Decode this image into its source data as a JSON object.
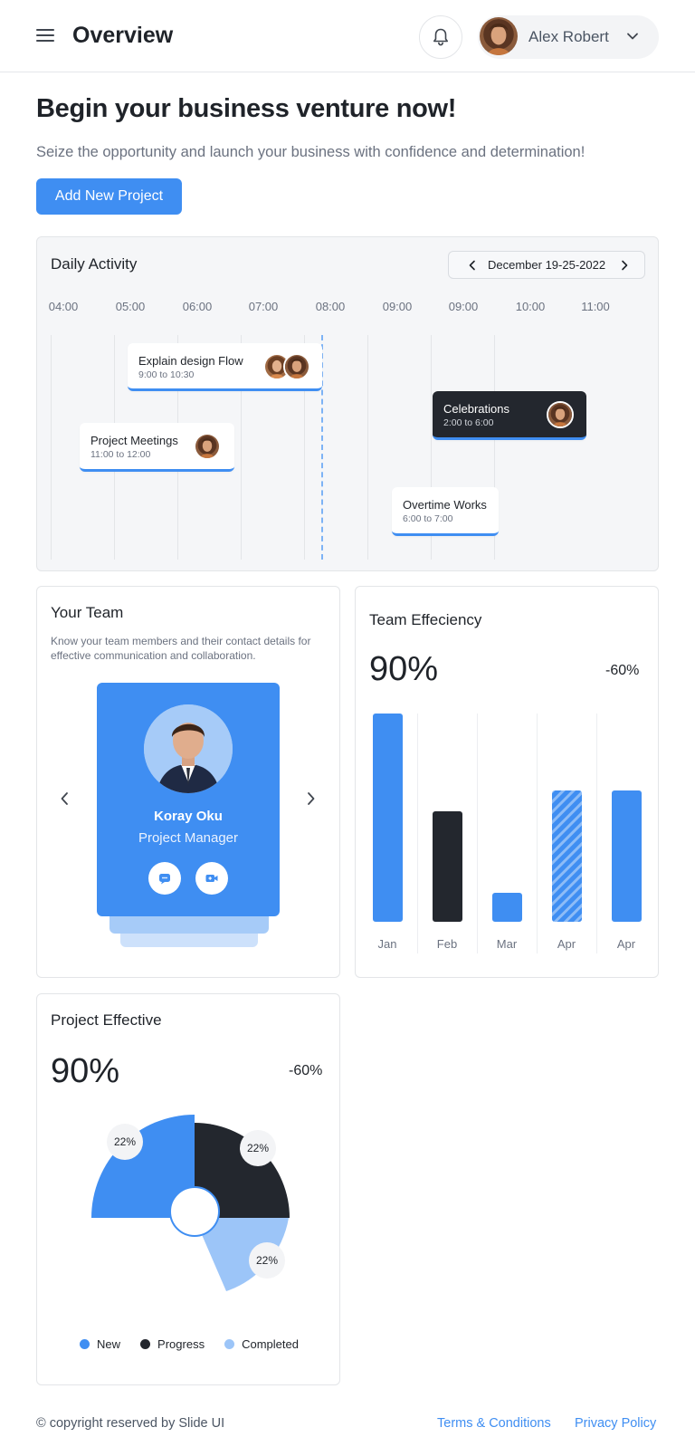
{
  "header": {
    "title": "Overview",
    "user_name": "Alex Robert"
  },
  "hero": {
    "title": "Begin your business venture now!",
    "subtitle": "Seize the opportunity and launch your business with confidence and determination!",
    "add_button": "Add New Project"
  },
  "activity": {
    "title": "Daily Activity",
    "date_range": "December 19-25-2022",
    "times": [
      "04:00",
      "05:00",
      "06:00",
      "07:00",
      "08:00",
      "09:00",
      "09:00",
      "10:00",
      "11:00"
    ],
    "events": [
      {
        "title": "Explain design Flow",
        "time": "9:00 to 10:30"
      },
      {
        "title": "Project Meetings",
        "time": "11:00 to 12:00"
      },
      {
        "title": "Celebrations",
        "time": "2:00 to 6:00"
      },
      {
        "title": "Overtime Works",
        "time": "6:00 to 7:00"
      }
    ]
  },
  "team": {
    "title": "Your Team",
    "description": "Know your team members and their contact details for effective communication and collaboration.",
    "member": {
      "name": "Koray Oku",
      "role": "Project Manager"
    }
  },
  "efficiency": {
    "title": "Team Effeciency",
    "value": "90%",
    "delta": "-60%",
    "months": [
      "Jan",
      "Feb",
      "Mar",
      "Apr",
      "Apr"
    ],
    "bar_levels": [
      1.0,
      0.53,
      0.14,
      0.63,
      0.63
    ],
    "bar_styles": [
      "blue",
      "dark",
      "blue",
      "striped",
      "blue"
    ]
  },
  "project": {
    "title": "Project Effective",
    "value": "90%",
    "delta": "-60%",
    "slices": [
      {
        "label": "22%",
        "legend": "New",
        "color": "#3f8ef2"
      },
      {
        "label": "22%",
        "legend": "Progress",
        "color": "#23272e"
      },
      {
        "label": "22%",
        "legend": "Completed",
        "color": "#9cc5f8"
      }
    ]
  },
  "footer": {
    "copyright": "© copyright reserved by Slide UI",
    "terms": "Terms & Conditions",
    "privacy": "Privacy Policy"
  },
  "colors": {
    "accent": "#3f8ef2",
    "dark": "#23272e",
    "light_blue": "#9cc5f8"
  }
}
